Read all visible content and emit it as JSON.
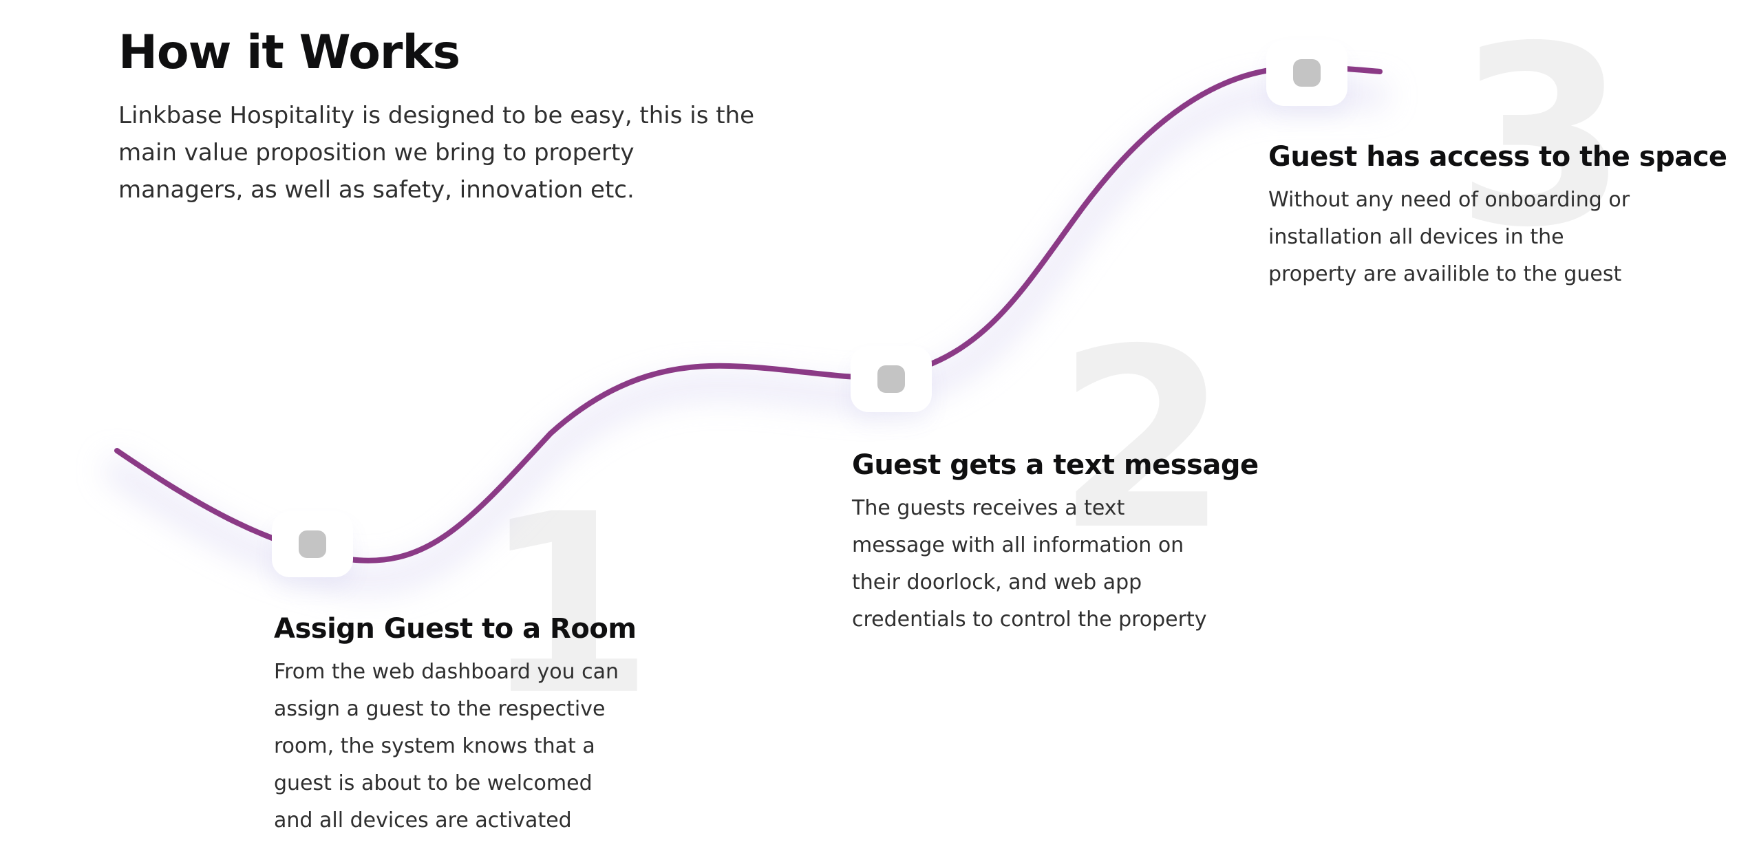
{
  "header": {
    "title": "How it Works",
    "subtitle": "Linkbase Hospitality is designed to be easy, this is the main value proposition we bring to property managers, as well as safety, innovation etc."
  },
  "theme": {
    "curve_color": "#8B3A86",
    "dot_color": "#C4C4C4",
    "number_color": "#F0F0F0",
    "title_color": "#0F0F10",
    "text_color": "#2F2F2F"
  },
  "steps": [
    {
      "number": "1",
      "title": "Assign Guest to a Room",
      "description": "From the web dashboard you can assign a guest to the respective room, the system knows that a guest is about to be welcomed and all devices are activated"
    },
    {
      "number": "2",
      "title": "Guest gets a text message",
      "description": "The guests receives a text message with all information on their doorlock, and web app credentials to control the property"
    },
    {
      "number": "3",
      "title": "Guest has access to the space",
      "description": "Without any need of onboarding or installation all devices in the property are availible to the guest"
    }
  ]
}
